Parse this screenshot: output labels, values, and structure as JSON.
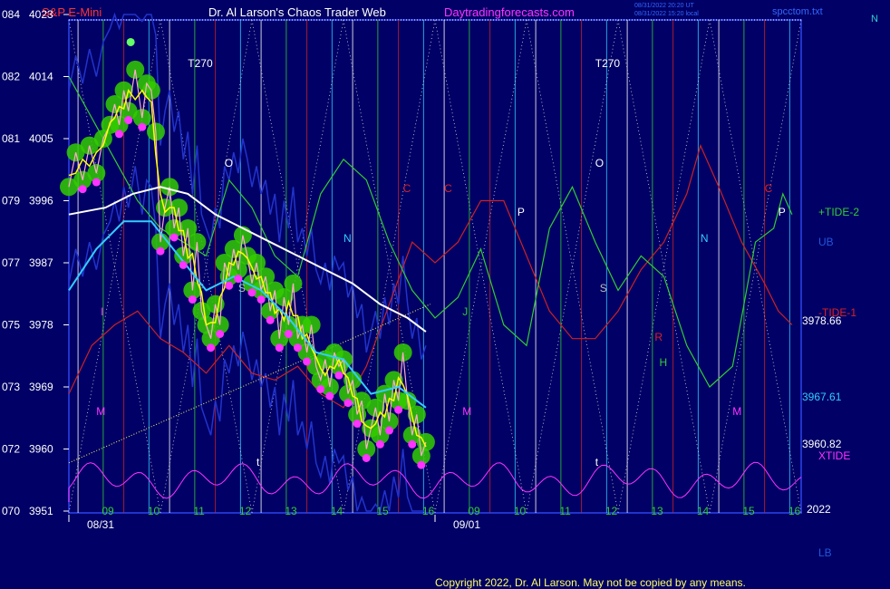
{
  "header": {
    "symbol": "S&P E-Mini",
    "site": "Dr. Al Larson's Chaos Trader Web",
    "url": "Daytradingforecasts.com",
    "timestamp1": "08/31/2022 20:20 UT",
    "timestamp2": "08/31/2022 15:20 local",
    "file": "spcctom.txt",
    "corner": "N"
  },
  "copyright": "Copyright 2022, Dr. Al Larson. May not be copied by any means.",
  "colors": {
    "background": "#000066",
    "grid": "#c8c8c8",
    "white_line": "#ffffff",
    "cyan_line": "#33ccff",
    "yellow_line": "#ffff00",
    "green_band": "#33cc00",
    "magenta": "#ff33ff",
    "tide1": "#cc2222",
    "tide2": "#33cc33",
    "blue_band": "#2233cc"
  },
  "chart_data": {
    "type": "line",
    "left_axis": {
      "labels": [
        {
          "hi": "084",
          "price": "4023"
        },
        {
          "hi": "082",
          "price": "4014"
        },
        {
          "hi": "081",
          "price": "4005"
        },
        {
          "hi": "079",
          "price": "3996"
        },
        {
          "hi": "077",
          "price": "3987"
        },
        {
          "hi": "075",
          "price": "3978"
        },
        {
          "hi": "073",
          "price": "3969"
        },
        {
          "hi": "072",
          "price": "3960"
        },
        {
          "hi": "070",
          "price": "3951"
        }
      ],
      "ylim": [
        3951,
        4023
      ]
    },
    "hour_labels": [
      "09",
      "10",
      "11",
      "12",
      "13",
      "14",
      "15",
      "16",
      "09",
      "10",
      "11",
      "12",
      "13",
      "14",
      "15",
      "16"
    ],
    "dates": [
      "08/31",
      "09/01"
    ],
    "year": "2022",
    "right_labels": {
      "tide2": "+TIDE-2",
      "ub": "UB",
      "tide1": "-TIDE-1",
      "v1": "3978.66",
      "v2": "3967.61",
      "v3": "3960.82",
      "xtide": "XTIDE",
      "lb": "LB"
    },
    "markers": [
      {
        "t": "T270",
        "x": 2.6
      },
      {
        "t": "T270",
        "x": 11.5
      },
      {
        "t": "O",
        "x": 3.4
      },
      {
        "t": "O",
        "x": 11.5
      },
      {
        "t": "C",
        "x": 7.3
      },
      {
        "t": "C",
        "x": 8.2
      },
      {
        "t": "C",
        "x": 15.2
      },
      {
        "t": "N",
        "x": 6.0
      },
      {
        "t": "N",
        "x": 13.8
      },
      {
        "t": "P",
        "x": 9.8
      },
      {
        "t": "P",
        "x": 15.5
      },
      {
        "t": "S",
        "x": 3.7
      },
      {
        "t": "S",
        "x": 11.6
      },
      {
        "t": "J",
        "x": 8.6
      },
      {
        "t": "R",
        "x": 12.8
      },
      {
        "t": "H",
        "x": 12.9
      },
      {
        "t": "M",
        "x": 0.6
      },
      {
        "t": "M",
        "x": 8.6
      },
      {
        "t": "M",
        "x": 14.5
      },
      {
        "t": "t",
        "x": 4.1
      },
      {
        "t": "t",
        "x": 11.5
      },
      {
        "t": "l",
        "x": 0.7
      }
    ],
    "price_series": [
      [
        0,
        3998
      ],
      [
        0.15,
        4003
      ],
      [
        0.3,
        3999
      ],
      [
        0.45,
        4004
      ],
      [
        0.6,
        4000
      ],
      [
        0.75,
        4005
      ],
      [
        0.9,
        4007
      ],
      [
        1.0,
        4010
      ],
      [
        1.1,
        4007
      ],
      [
        1.2,
        4012
      ],
      [
        1.3,
        4009
      ],
      [
        1.45,
        4015
      ],
      [
        1.6,
        4008
      ],
      [
        1.7,
        4013
      ],
      [
        1.8,
        4012
      ],
      [
        1.9,
        4006
      ],
      [
        2.0,
        3990
      ],
      [
        2.1,
        3995
      ],
      [
        2.2,
        3998
      ],
      [
        2.3,
        3992
      ],
      [
        2.4,
        3995
      ],
      [
        2.5,
        3988
      ],
      [
        2.6,
        3992
      ],
      [
        2.7,
        3983
      ],
      [
        2.8,
        3990
      ],
      [
        2.9,
        3980
      ],
      [
        3.0,
        3978
      ],
      [
        3.1,
        3976
      ],
      [
        3.2,
        3981
      ],
      [
        3.3,
        3978
      ],
      [
        3.4,
        3987
      ],
      [
        3.5,
        3985
      ],
      [
        3.6,
        3989
      ],
      [
        3.7,
        3986
      ],
      [
        3.8,
        3991
      ],
      [
        3.9,
        3988
      ],
      [
        4.0,
        3984
      ],
      [
        4.1,
        3987
      ],
      [
        4.2,
        3983
      ],
      [
        4.3,
        3985
      ],
      [
        4.4,
        3980
      ],
      [
        4.5,
        3983
      ],
      [
        4.6,
        3976
      ],
      [
        4.7,
        3982
      ],
      [
        4.8,
        3978
      ],
      [
        4.9,
        3984
      ],
      [
        5.0,
        3976
      ],
      [
        5.1,
        3978
      ],
      [
        5.2,
        3974
      ],
      [
        5.3,
        3978
      ],
      [
        5.4,
        3972
      ],
      [
        5.5,
        3970
      ],
      [
        5.6,
        3973
      ],
      [
        5.7,
        3969
      ],
      [
        5.8,
        3974
      ],
      [
        5.9,
        3972
      ],
      [
        6.0,
        3973
      ],
      [
        6.1,
        3968
      ],
      [
        6.2,
        3970
      ],
      [
        6.3,
        3965
      ],
      [
        6.4,
        3967
      ],
      [
        6.5,
        3960
      ],
      [
        6.6,
        3963
      ],
      [
        6.7,
        3966
      ],
      [
        6.8,
        3962
      ],
      [
        6.9,
        3968
      ],
      [
        7.0,
        3964
      ],
      [
        7.1,
        3970
      ],
      [
        7.2,
        3967
      ],
      [
        7.3,
        3974
      ],
      [
        7.4,
        3967
      ],
      [
        7.5,
        3962
      ],
      [
        7.6,
        3965
      ],
      [
        7.7,
        3959
      ],
      [
        7.8,
        3961
      ]
    ],
    "tide1_series": [
      [
        0,
        3968
      ],
      [
        0.5,
        3975
      ],
      [
        1.0,
        3978
      ],
      [
        1.5,
        3980
      ],
      [
        2.0,
        3976
      ],
      [
        2.5,
        3974
      ],
      [
        3.0,
        3971
      ],
      [
        3.5,
        3975
      ],
      [
        4.0,
        3971
      ],
      [
        4.5,
        3970
      ],
      [
        5.0,
        3972
      ],
      [
        5.5,
        3968
      ],
      [
        6.0,
        3966
      ],
      [
        6.5,
        3972
      ],
      [
        7.0,
        3981
      ],
      [
        7.5,
        3990
      ],
      [
        8.0,
        3987
      ],
      [
        8.5,
        3990
      ],
      [
        9.0,
        3996
      ],
      [
        9.5,
        3996
      ],
      [
        10.0,
        3988
      ],
      [
        10.5,
        3980
      ],
      [
        11.0,
        3976
      ],
      [
        11.5,
        3976
      ],
      [
        12.0,
        3980
      ],
      [
        12.5,
        3986
      ],
      [
        13.0,
        3990
      ],
      [
        13.5,
        3997
      ],
      [
        13.8,
        4004
      ],
      [
        14.2,
        3998
      ],
      [
        14.7,
        3990
      ],
      [
        15.2,
        3984
      ],
      [
        15.5,
        3980
      ],
      [
        15.8,
        3978
      ]
    ],
    "tide2_series": [
      [
        0,
        4014
      ],
      [
        0.5,
        4008
      ],
      [
        1.0,
        4002
      ],
      [
        1.5,
        3996
      ],
      [
        2.0,
        3992
      ],
      [
        2.5,
        3990
      ],
      [
        3.0,
        3988
      ],
      [
        3.5,
        3999
      ],
      [
        4.0,
        3995
      ],
      [
        4.5,
        3988
      ],
      [
        5.0,
        3985
      ],
      [
        5.5,
        3997
      ],
      [
        6.0,
        4002
      ],
      [
        6.5,
        3999
      ],
      [
        7.0,
        3990
      ],
      [
        7.5,
        3983
      ],
      [
        8.0,
        3979
      ],
      [
        8.5,
        3982
      ],
      [
        9.0,
        3989
      ],
      [
        9.5,
        3978
      ],
      [
        10.0,
        3975
      ],
      [
        10.5,
        3992
      ],
      [
        11.0,
        3998
      ],
      [
        11.5,
        3990
      ],
      [
        12.0,
        3983
      ],
      [
        12.5,
        3988
      ],
      [
        13.0,
        3985
      ],
      [
        13.5,
        3975
      ],
      [
        14.0,
        3969
      ],
      [
        14.5,
        3972
      ],
      [
        15.0,
        3990
      ],
      [
        15.4,
        3992
      ],
      [
        15.6,
        3997
      ],
      [
        15.8,
        3994
      ]
    ],
    "white_series": [
      [
        0,
        3994
      ],
      [
        0.8,
        3995
      ],
      [
        1.4,
        3997
      ],
      [
        2.0,
        3998
      ],
      [
        2.6,
        3997
      ],
      [
        3.2,
        3994
      ],
      [
        3.8,
        3992
      ],
      [
        4.4,
        3990
      ],
      [
        5.0,
        3988
      ],
      [
        5.6,
        3986
      ],
      [
        6.2,
        3984
      ],
      [
        6.8,
        3981
      ],
      [
        7.4,
        3979
      ],
      [
        7.8,
        3977
      ]
    ],
    "cyan_series": [
      [
        0,
        3983
      ],
      [
        0.6,
        3989
      ],
      [
        1.2,
        3993
      ],
      [
        1.8,
        3993
      ],
      [
        2.4,
        3988
      ],
      [
        3.0,
        3983
      ],
      [
        3.6,
        3985
      ],
      [
        4.2,
        3983
      ],
      [
        4.8,
        3979
      ],
      [
        5.4,
        3974
      ],
      [
        6.0,
        3973
      ],
      [
        6.6,
        3968
      ],
      [
        7.2,
        3969
      ],
      [
        7.8,
        3966
      ]
    ],
    "trend_line": [
      [
        0,
        3958
      ],
      [
        7.9,
        3981
      ]
    ]
  }
}
